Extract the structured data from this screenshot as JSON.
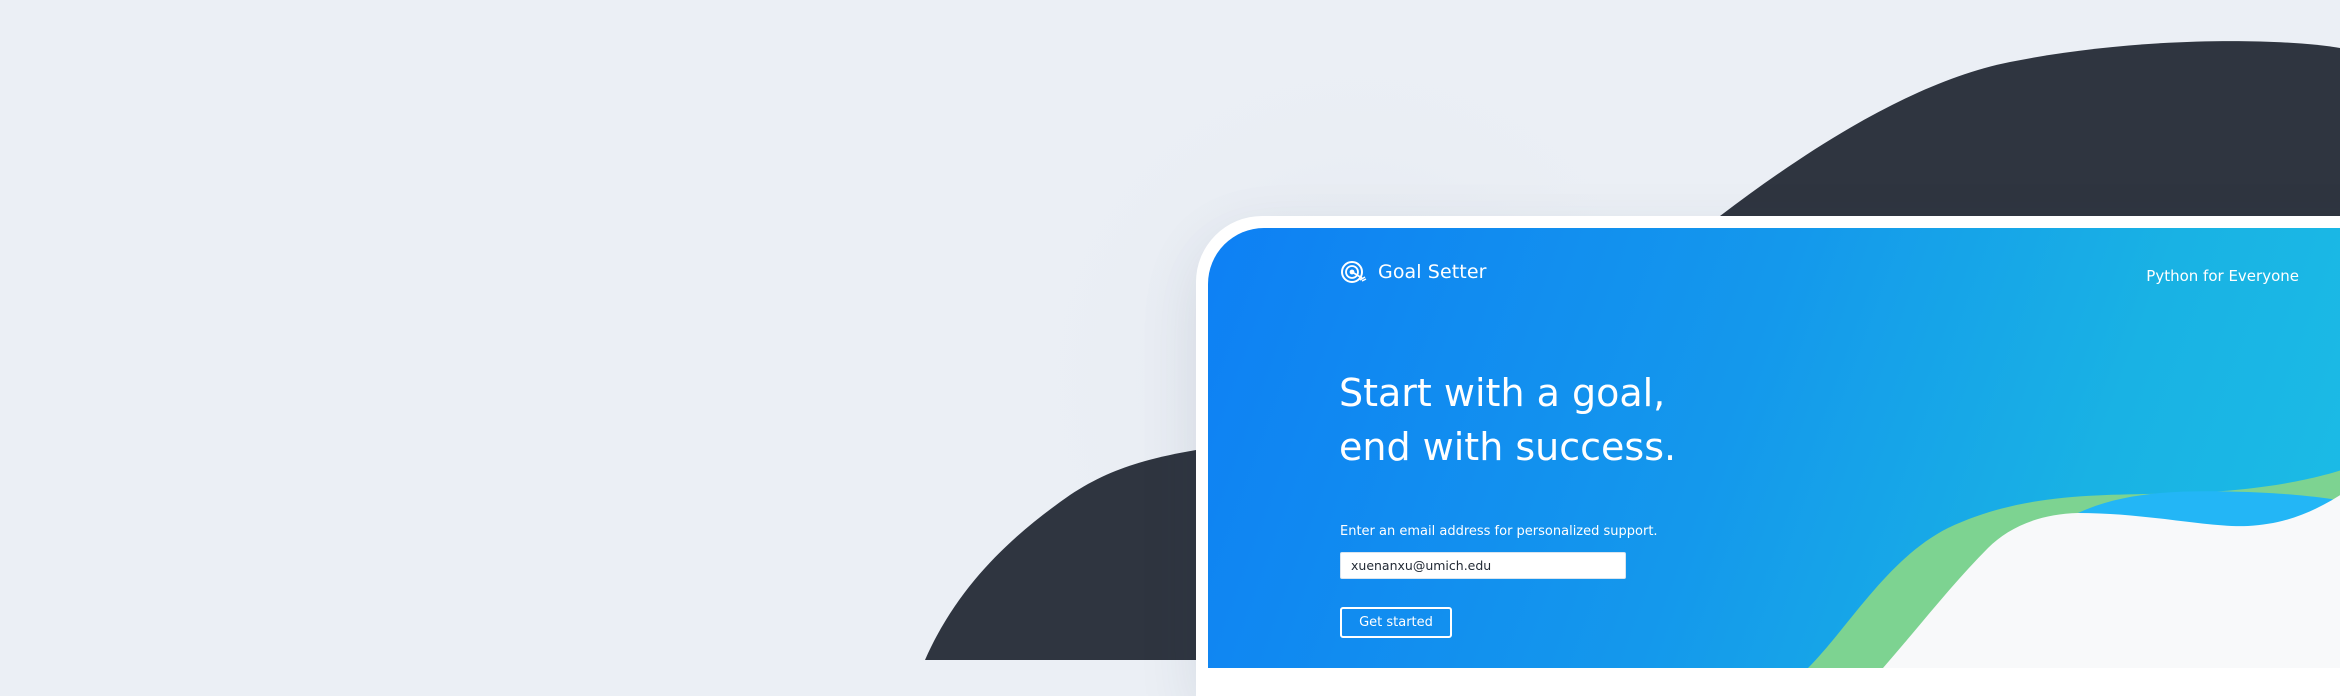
{
  "header": {
    "brand_name": "Goal Setter",
    "brand_icon": "target-arrow-icon",
    "nav_link": "Python for Everyone"
  },
  "hero": {
    "headline_line1": "Start with a goal,",
    "headline_line2": "end with success."
  },
  "signup": {
    "label": "Enter an email address for personalized support.",
    "email_value": "xuenanxu@umich.edu",
    "button_label": "Get started"
  },
  "colors": {
    "page_background": "#ebeff5",
    "dark_blob": "#2f3540",
    "gradient_start": "#0e80f4",
    "gradient_end": "#1cbde6",
    "green_wave": "#7dd391",
    "light_blue_wave": "#23b6f6",
    "white_surface": "#f8f9fa"
  }
}
